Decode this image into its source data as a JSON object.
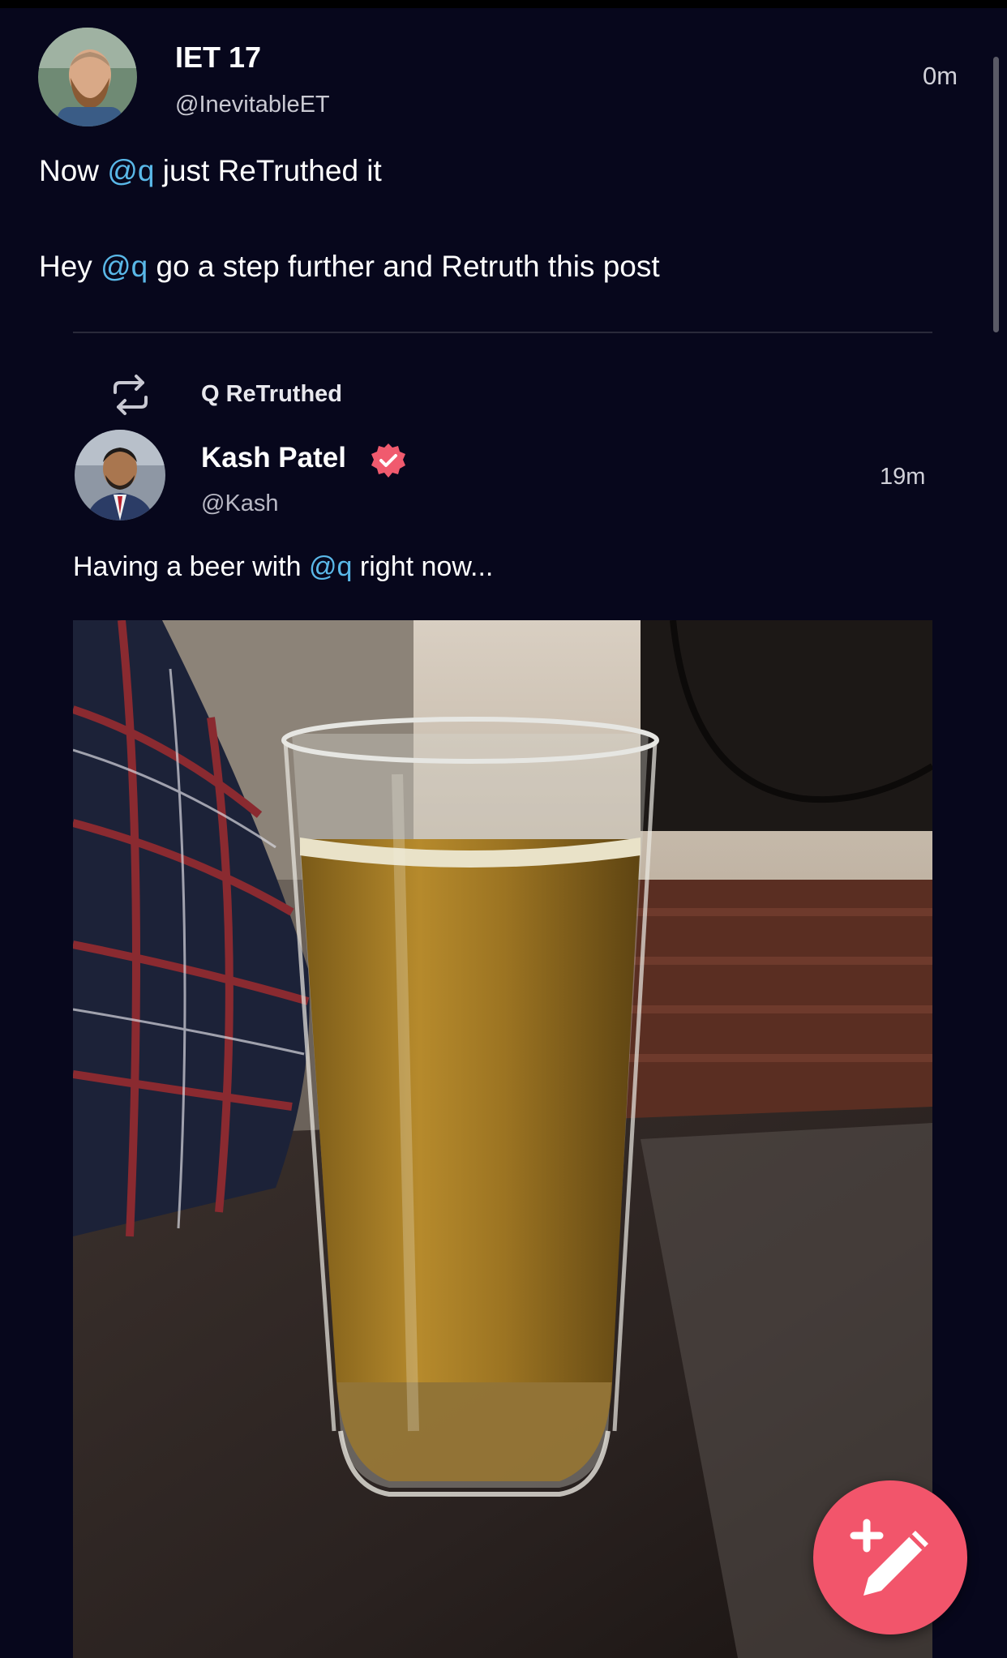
{
  "post": {
    "author_name": "IET 17",
    "author_handle": "@InevitableET",
    "time": "0m",
    "line1": {
      "before": "Now ",
      "mention": "@q",
      "after": " just ReTruthed it"
    },
    "line2": {
      "before": "Hey ",
      "mention": "@q",
      "after": " go a step further and Retruth this post"
    }
  },
  "quoted": {
    "retruth_label": "Q ReTruthed",
    "author_name": "Kash Patel",
    "author_handle": "@Kash",
    "time": "19m",
    "text": {
      "before": "Having a beer with ",
      "mention": "@q",
      "after": " right now..."
    }
  },
  "icons": {
    "retruth": "retruth-icon",
    "verified": "verified-badge-icon",
    "compose": "compose-pencil-icon"
  },
  "colors": {
    "background": "#07071c",
    "mention": "#5ab8e8",
    "accent": "#f2556b"
  }
}
